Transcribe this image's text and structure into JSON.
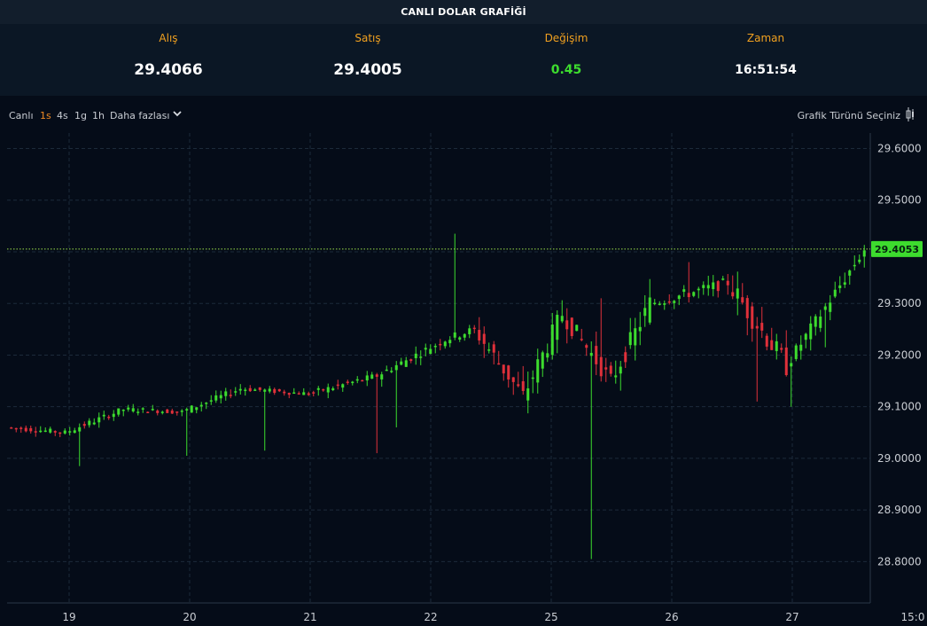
{
  "title": "CANLI DOLAR GRAFİĞİ",
  "stats": [
    {
      "label": "Alış",
      "value": "29.4066"
    },
    {
      "label": "Satış",
      "value": "29.4005"
    },
    {
      "label": "Değişim",
      "value": "0.45"
    },
    {
      "label": "Zaman",
      "value": "16:51:54"
    }
  ],
  "colors": {
    "up": "#3ddc2e",
    "down": "#e0303a",
    "accent": "#f08a24",
    "background": "#050c18"
  },
  "toolbar": {
    "live_label": "Canlı",
    "intervals": [
      "1s",
      "4s",
      "1g",
      "1h"
    ],
    "active_interval": "1s",
    "more_label": "Daha fazlası",
    "chart_type_label": "Grafik Türünü Seçiniz",
    "chart_type_icon": "candlestick-icon",
    "more_icon": "chevron-down-icon"
  },
  "chart_data": {
    "type": "candlestick",
    "ylim": [
      28.72,
      29.63
    ],
    "y_ticks": [
      "29.6000",
      "29.5000",
      "29.4000",
      "29.3000",
      "29.2000",
      "29.1000",
      "29.0000",
      "28.9000",
      "28.8000"
    ],
    "x_ticks": [
      "19",
      "20",
      "21",
      "22",
      "25",
      "26",
      "27",
      "15:0"
    ],
    "grid": true,
    "last_price": "29.4053",
    "last_price_value": 29.4053,
    "segments": [
      {
        "start": 29.06,
        "end": 29.05,
        "vol": 0.01,
        "n": 12
      },
      {
        "start": 29.05,
        "end": 29.095,
        "vol": 0.012,
        "n": 12
      },
      {
        "start": 29.095,
        "end": 29.09,
        "vol": 0.01,
        "n": 12
      },
      {
        "start": 29.09,
        "end": 29.135,
        "vol": 0.012,
        "n": 12
      },
      {
        "start": 29.135,
        "end": 29.125,
        "vol": 0.01,
        "n": 14
      },
      {
        "start": 29.125,
        "end": 29.16,
        "vol": 0.013,
        "n": 14
      },
      {
        "start": 29.16,
        "end": 29.23,
        "vol": 0.016,
        "n": 14
      },
      {
        "start": 29.23,
        "end": 29.25,
        "vol": 0.016,
        "n": 6
      },
      {
        "start": 29.25,
        "end": 29.12,
        "vol": 0.035,
        "n": 10
      },
      {
        "start": 29.12,
        "end": 29.28,
        "vol": 0.04,
        "n": 8
      },
      {
        "start": 29.28,
        "end": 29.15,
        "vol": 0.035,
        "n": 10
      },
      {
        "start": 29.15,
        "end": 29.3,
        "vol": 0.04,
        "n": 8
      },
      {
        "start": 29.3,
        "end": 29.34,
        "vol": 0.022,
        "n": 16
      },
      {
        "start": 29.34,
        "end": 29.18,
        "vol": 0.045,
        "n": 12
      },
      {
        "start": 29.18,
        "end": 29.405,
        "vol": 0.025,
        "n": 16
      }
    ],
    "spikes": [
      {
        "frac": 0.08,
        "low": 28.985
      },
      {
        "frac": 0.21,
        "low": 29.005
      },
      {
        "frac": 0.3,
        "low": 29.015
      },
      {
        "frac": 0.43,
        "low": 29.01
      },
      {
        "frac": 0.52,
        "high": 29.435
      },
      {
        "frac": 0.45,
        "low": 29.06
      },
      {
        "frac": 0.68,
        "low": 28.805
      },
      {
        "frac": 0.68,
        "low": 28.845
      },
      {
        "frac": 0.69,
        "high": 29.31
      },
      {
        "frac": 0.79,
        "high": 29.38
      },
      {
        "frac": 0.87,
        "low": 29.11
      },
      {
        "frac": 0.91,
        "low": 29.1
      },
      {
        "frac": 0.95,
        "low": 29.215
      }
    ]
  }
}
